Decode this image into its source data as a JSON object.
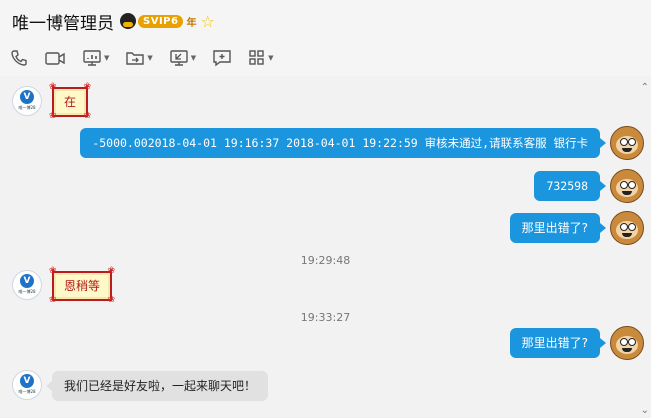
{
  "header": {
    "title": "唯一博管理员",
    "vip_label": "SVIP6",
    "year_label": "年"
  },
  "toolbar": {
    "icons": [
      "phone-icon",
      "video-call-icon",
      "screen-share-icon",
      "file-transfer-icon",
      "remote-assist-icon",
      "add-message-icon",
      "apps-grid-icon"
    ]
  },
  "contact_avatar": {
    "caption": "唯一博28"
  },
  "messages": {
    "m1": "在",
    "m2": "-5000.002018-04-01 19:16:37  2018-04-01 19:22:59  审核未通过,请联系客服 银行卡",
    "m3": "732598",
    "m4": "那里出错了?",
    "t1": "19:29:48",
    "m5": "恩稍等",
    "t2": "19:33:27",
    "m6": "那里出错了?",
    "m7": "我们已经是好友啦，一起来聊天吧！"
  },
  "colors": {
    "sent_bubble": "#1b95de",
    "received_bubble": "#e1e1e1",
    "scroll_card_border": "#b81c1c",
    "scroll_card_bg": "#fff8c8",
    "background": "#f2f2f2"
  }
}
